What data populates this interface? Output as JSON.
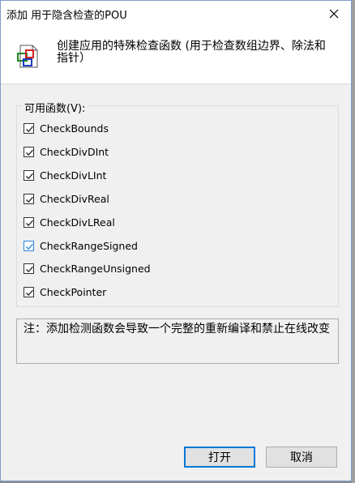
{
  "window": {
    "title": "添加 用于隐含检查的POU",
    "close_glyph": "✕"
  },
  "header": {
    "icon": "pou-document-icon",
    "description": "创建应用的特殊检查函数 (用于检查数组边界、除法和指针）"
  },
  "functions": {
    "group_label": "可用函数(V):",
    "items": [
      {
        "label": "CheckBounds",
        "checked": true
      },
      {
        "label": "CheckDivDInt",
        "checked": true
      },
      {
        "label": "CheckDivLInt",
        "checked": true
      },
      {
        "label": "CheckDivReal",
        "checked": true
      },
      {
        "label": "CheckDivLReal",
        "checked": true
      },
      {
        "label": "CheckRangeSigned",
        "checked": true,
        "focused": true
      },
      {
        "label": "CheckRangeUnsigned",
        "checked": true
      },
      {
        "label": "CheckPointer",
        "checked": true
      }
    ]
  },
  "note": {
    "text": "注：添加检测函数会导致一个完整的重新编译和禁止在线改变"
  },
  "buttons": {
    "open_label": "打开",
    "cancel_label": "取消"
  },
  "colors": {
    "focus_accent": "#2b84d9",
    "default_button_border": "#0078d7"
  }
}
